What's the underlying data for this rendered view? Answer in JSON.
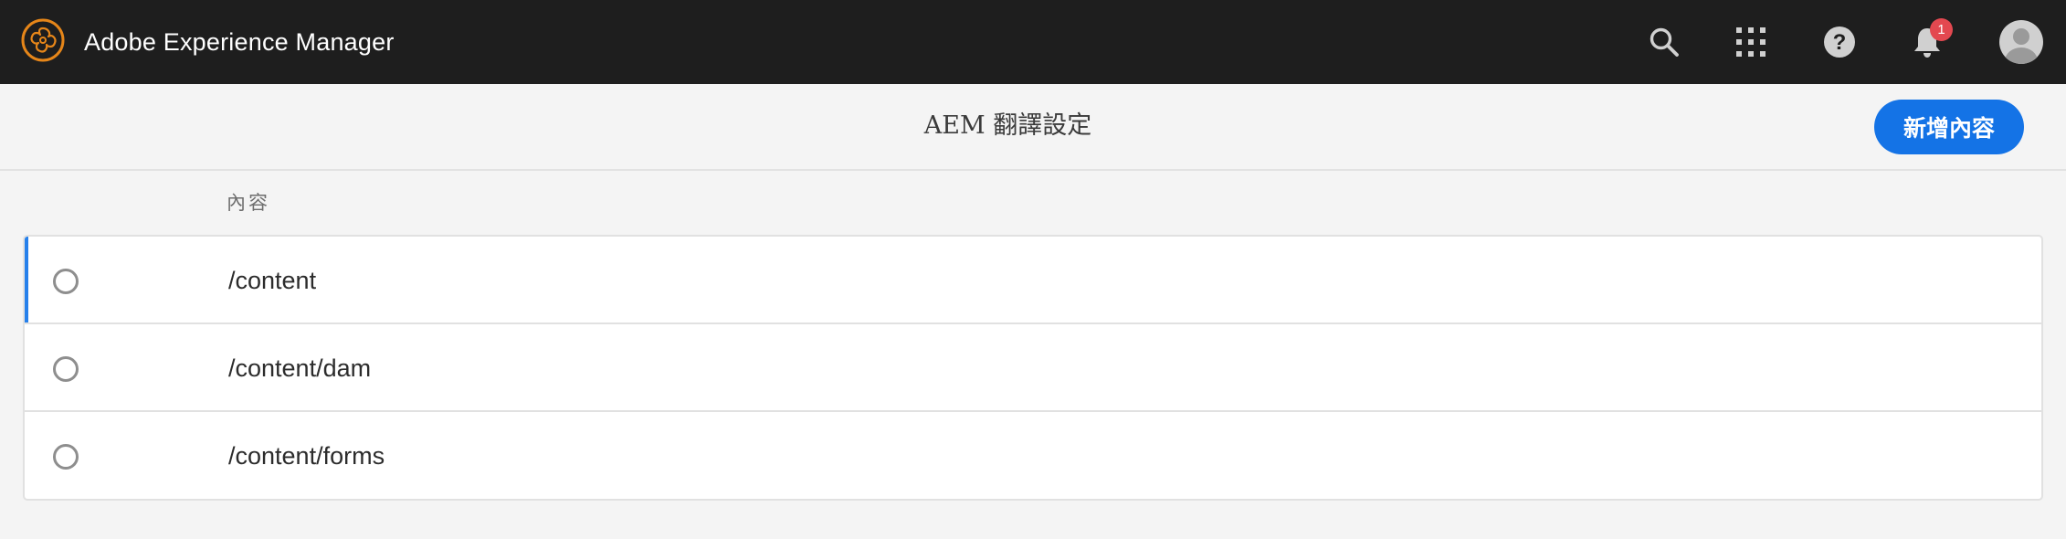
{
  "shell": {
    "app_title": "Adobe Experience Manager",
    "logo_color": "#e68619",
    "actions": {
      "search_icon": "search-icon",
      "apps_icon": "apps-grid-icon",
      "help_icon": "help-icon",
      "notifications_icon": "bell-icon",
      "notification_count": "1",
      "profile_icon": "user-avatar-icon"
    }
  },
  "actionbar": {
    "title": "AEM 翻譯設定",
    "add_button_label": "新增內容",
    "accent_color": "#1473e6"
  },
  "table": {
    "column_header": "內容",
    "rows": [
      {
        "label": "/content",
        "selected": true
      },
      {
        "label": "/content/dam",
        "selected": false
      },
      {
        "label": "/content/forms",
        "selected": false
      }
    ]
  }
}
